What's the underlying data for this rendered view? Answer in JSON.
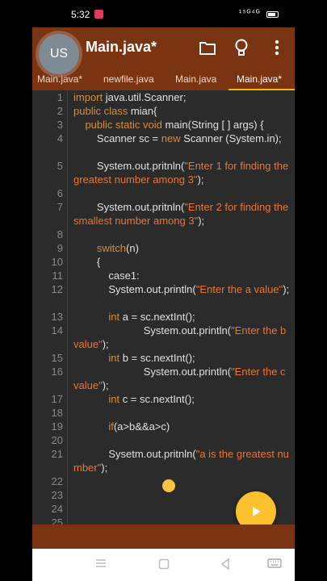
{
  "status_bar": {
    "time": "5:32",
    "signal_text": "¹⁵ᴳ⁴ᴳ"
  },
  "toolbar": {
    "avatar_initials": "US",
    "title": "Main.java*"
  },
  "tabs": [
    {
      "label": "Main.java*"
    },
    {
      "label": "newfile.java"
    },
    {
      "label": "Main.java"
    },
    {
      "label": "Main.java*"
    }
  ],
  "line_numbers": [
    "1",
    "2",
    "3",
    "4",
    "5",
    "6",
    "7",
    "8",
    "9",
    "10",
    "11",
    "12",
    "13",
    "14",
    "15",
    "16",
    "17",
    "18",
    "19",
    "20",
    "21",
    "22",
    "23",
    "24",
    "25"
  ],
  "code": {
    "l1": [
      "import",
      " java.util.Scanner;"
    ],
    "l2": [
      "public class",
      " mian{"
    ],
    "l3": [
      "    public static void",
      " main(String [ ] args) {"
    ],
    "l4": [
      "        Scanner sc = ",
      "new",
      " Scanner (System.in);"
    ],
    "l5": [
      "        System.out.pritnln(",
      "\"Enter 1 for finding the greatest number among 3\"",
      ");"
    ],
    "l7": [
      "        System.out.pritnln(",
      "\"Enter 2 for finding the smallest number among 3\"",
      ");"
    ],
    "l9": [
      "        ",
      "switch",
      "(n)"
    ],
    "l10": [
      "        {"
    ],
    "l11": [
      "            case1:"
    ],
    "l12": [
      "            System.out.println(",
      "\"Enter the a value\"",
      ");"
    ],
    "l13": [
      "            ",
      "int",
      " a = sc.nextInt();"
    ],
    "l14": [
      "                        System.out.println(",
      "\"Enter the b value\"",
      ");"
    ],
    "l15": [
      "            ",
      "int",
      " b = sc.nextInt();"
    ],
    "l16": [
      "                        System.out.println(",
      "\"Enter the c value\"",
      ");"
    ],
    "l17": [
      "            ",
      "int",
      " c = sc.nextInt();"
    ],
    "l19": [
      "            ",
      "if",
      "(a>b&&a>c)"
    ],
    "l21": [
      "            Sysetm.out.pritnln(",
      "\"a is the greatest number\"",
      ");"
    ]
  },
  "colors": {
    "toolbar": "#7a3412",
    "editor_bg": "#2b2b2b",
    "accent": "#fbc02d",
    "keyword": "#d98c3a",
    "string": "#e8753a"
  },
  "icons": {
    "folder": "folder-icon",
    "bulb": "lightbulb-icon",
    "menu": "more-vert-icon",
    "run": "play-icon"
  }
}
